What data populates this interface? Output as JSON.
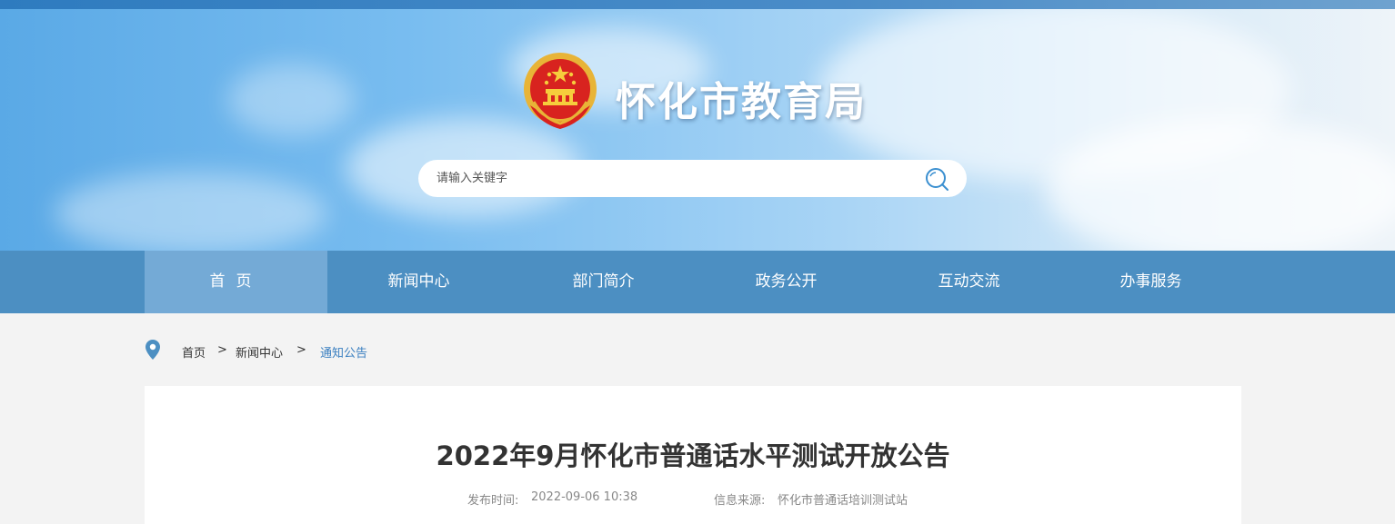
{
  "header": {
    "site_title": "怀化市教育局",
    "emblem_icon": "national-emblem-icon"
  },
  "search": {
    "placeholder": "请输入关键字",
    "value": "",
    "icon": "search-icon"
  },
  "nav": {
    "items": [
      {
        "label": "首页",
        "active": true
      },
      {
        "label": "新闻中心",
        "active": false
      },
      {
        "label": "部门简介",
        "active": false
      },
      {
        "label": "政务公开",
        "active": false
      },
      {
        "label": "互动交流",
        "active": false
      },
      {
        "label": "办事服务",
        "active": false
      }
    ]
  },
  "breadcrumb": {
    "icon": "location-pin-icon",
    "items": [
      "首页",
      "新闻中心",
      "通知公告"
    ],
    "separator": ">"
  },
  "article": {
    "title": "2022年9月怀化市普通话水平测试开放公告",
    "publish_label": "发布时间:",
    "publish_time": "2022-09-06 10:38",
    "source_label": "信息来源:",
    "source": "怀化市普通话培训测试站"
  },
  "colors": {
    "nav_bg": "#4c8fc2",
    "nav_active_bg": "#74aad6",
    "accent": "#3a7fc0",
    "title_text": "#333333",
    "meta_text": "#888888"
  }
}
